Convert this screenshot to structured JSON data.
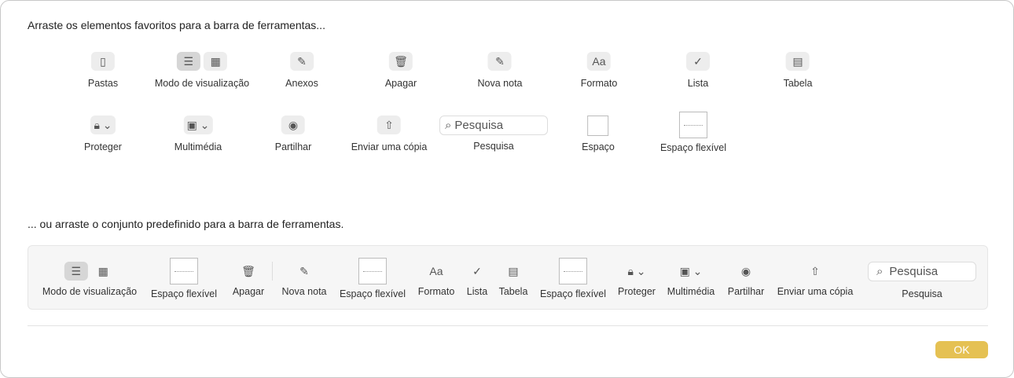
{
  "heading1": "Arraste os elementos favoritos para a barra de ferramentas...",
  "heading2": "... ou arraste o conjunto predefinido para a barra de ferramentas.",
  "items": {
    "pastas": "Pastas",
    "modo": "Modo de visualização",
    "anexos": "Anexos",
    "apagar": "Apagar",
    "nova_nota": "Nova nota",
    "formato": "Formato",
    "lista": "Lista",
    "tabela": "Tabela",
    "proteger": "Proteger",
    "multimedia": "Multimédia",
    "partilhar": "Partilhar",
    "enviar": "Enviar uma cópia",
    "pesquisa": "Pesquisa",
    "espaco": "Espaço",
    "espaco_flexivel": "Espaço flexível"
  },
  "search_placeholder": "Pesquisa",
  "format_glyph": "Aa",
  "ok_label": "OK"
}
